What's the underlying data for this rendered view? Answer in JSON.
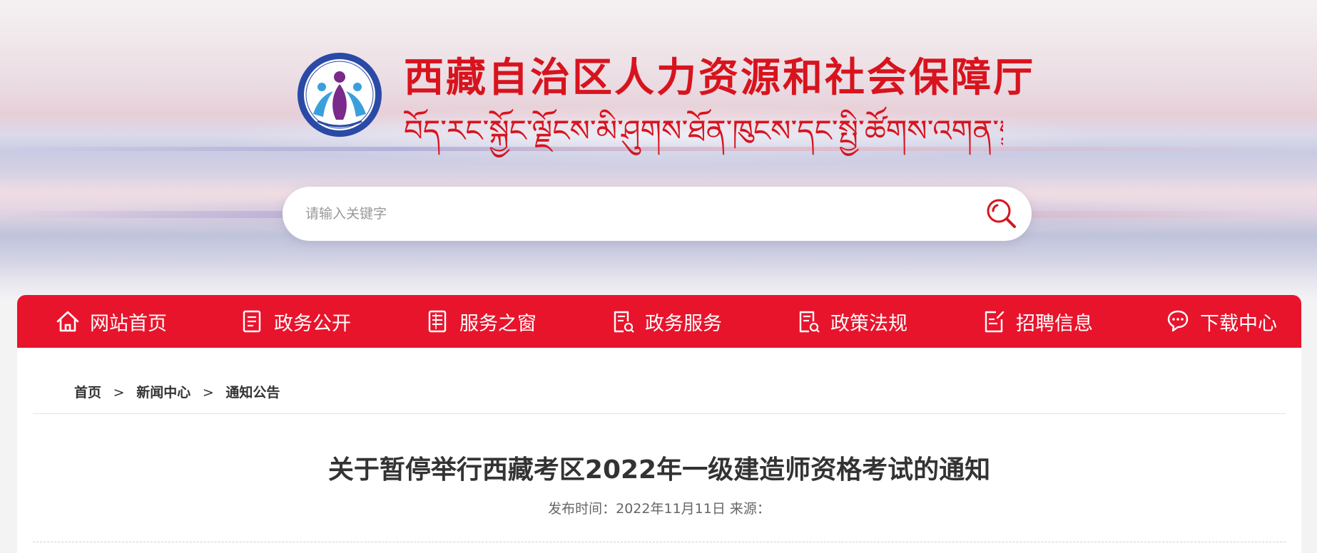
{
  "header": {
    "title": "西藏自治区人力资源和社会保障厅",
    "subtitle_tibetan": "བོད་རང་སྐྱོང་ལྗོངས་མི་ཤུགས་ཐོན་ཁུངས་དང་སྤྱི་ཚོགས་འགན་སྲུང་ཐིང་།",
    "logo_icon": "hrss-logo-emblem",
    "brand_color": "#d7141e"
  },
  "search": {
    "placeholder": "请输入关键字",
    "value": "",
    "icon": "search-icon"
  },
  "nav": {
    "background": "#e8142c",
    "items": [
      {
        "label": "网站首页",
        "icon": "home-icon"
      },
      {
        "label": "政务公开",
        "icon": "document-icon"
      },
      {
        "label": "服务之窗",
        "icon": "document-lines-icon"
      },
      {
        "label": "政务服务",
        "icon": "document-search-icon"
      },
      {
        "label": "政策法规",
        "icon": "document-search-icon"
      },
      {
        "label": "招聘信息",
        "icon": "edit-document-icon"
      },
      {
        "label": "下载中心",
        "icon": "chat-bubbles-icon"
      }
    ]
  },
  "breadcrumb": {
    "home": "首页",
    "separator": ">",
    "level1": "新闻中心",
    "level2": "通知公告"
  },
  "article": {
    "title": "关于暂停举行西藏考区2022年一级建造师资格考试的通知",
    "meta": "发布时间：2022年11月11日 来源："
  }
}
